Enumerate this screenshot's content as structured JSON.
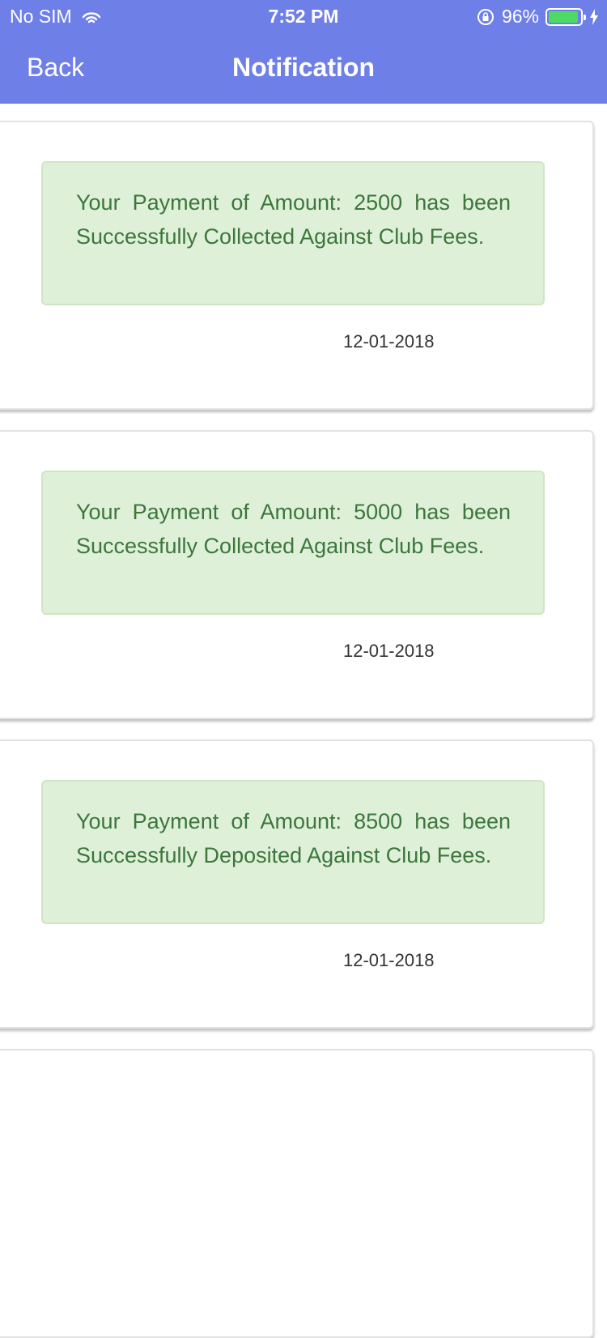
{
  "status_bar": {
    "carrier": "No SIM",
    "time": "7:52 PM",
    "battery_percent": "96%",
    "battery_level": 0.96,
    "battery_color": "#4cd964"
  },
  "nav_bar": {
    "back_label": "Back",
    "title": "Notification",
    "background_color": "#6f7fe8"
  },
  "notifications": [
    {
      "message": "Your Payment of Amount: 2500 has been Successfully Collected Against Club Fees.",
      "date": "12-01-2018"
    },
    {
      "message": "Your Payment of Amount: 5000 has been Successfully Collected Against Club Fees.",
      "date": "12-01-2018"
    },
    {
      "message": "Your Payment of Amount: 8500 has been Successfully Deposited Against Club Fees.",
      "date": "12-01-2018"
    }
  ],
  "icons": [
    "wifi-icon",
    "rotation-lock-icon",
    "battery-icon",
    "charging-bolt-icon"
  ]
}
